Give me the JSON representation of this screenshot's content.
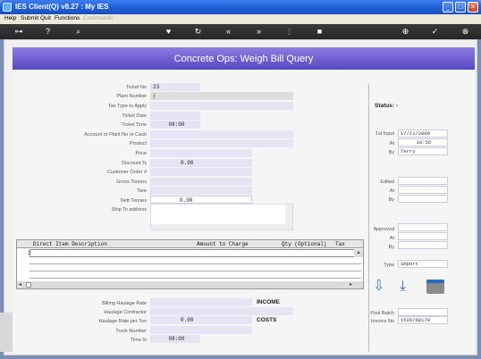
{
  "window": {
    "title": "IES Client(Q) v8.27 : My IES"
  },
  "menu": [
    "Help",
    "Submit",
    "Quit",
    "Functions",
    "Commands"
  ],
  "header": {
    "title": "Concrete Ops: Weigh Bill Query"
  },
  "form": {
    "ticket_no_label": "Ticket No",
    "ticket_no": "23",
    "plant_number_label": "Plant Number",
    "tax_type_label": "Tax Type to Apply",
    "ticket_date_label": "Ticket Date",
    "ticket_time_label": "Ticket Time",
    "ticket_time": "08:00",
    "account_label": "Account or Plant No or Cash",
    "product_label": "Product",
    "price_label": "Price",
    "discount_label": "Discount %",
    "discount": "0.00",
    "customer_order_label": "Customer Order #",
    "gross_label": "Gross Tonnes",
    "tare_label": "Tare",
    "nett_label": "Nett Tonnes",
    "nett": "0.00",
    "ship_label": "Ship To address"
  },
  "grid": {
    "headers": [
      "Direct Item Description",
      "Amount to Charge",
      "Qty (Optional)",
      "Tax"
    ],
    "row_number": "1"
  },
  "bottom": {
    "billing_label": "Billing Haulage Rate",
    "contractor_label": "Haulage Contractor",
    "haulage_rate_label": "Haulage Rate per Ton",
    "haulage_rate": "0.00",
    "truck_label": "Truck Number",
    "time_in_label": "Time In",
    "time_in": "08:00",
    "income_label": "INCOME",
    "costs_label": "COSTS"
  },
  "side": {
    "status_label": "Status: -",
    "first_input_label": "1st Input",
    "first_input": "17/11/2009",
    "at_label": "At",
    "at": "10:56",
    "by_label": "By",
    "by": "Terry",
    "edited_label": "Edited",
    "approved_label": "Approved",
    "type_label": "Type",
    "type": "import",
    "post_batch_label": "Post Batch",
    "invoice_label": "Invoice No",
    "invoice": "1529768178"
  },
  "colors": {
    "header_start": "#8c7ee0",
    "header_end": "#5647c4",
    "titlebar": "#1f5fd6"
  }
}
